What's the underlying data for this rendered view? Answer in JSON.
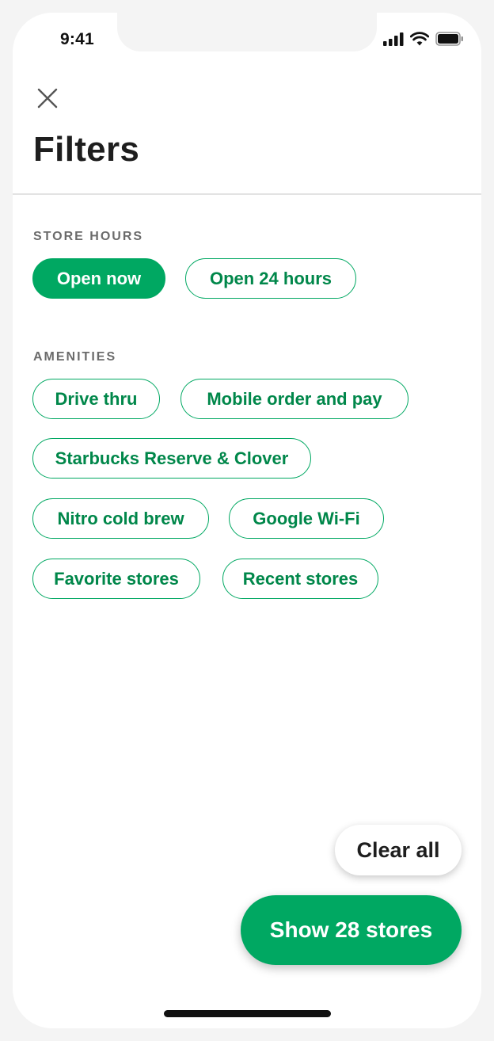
{
  "status_bar": {
    "time": "9:41",
    "icons": [
      "cellular-signal-icon",
      "wifi-icon",
      "battery-icon"
    ]
  },
  "header": {
    "close_icon": "close-icon",
    "title": "Filters"
  },
  "store_hours": {
    "label": "STORE HOURS",
    "chips": [
      {
        "label": "Open now",
        "selected": true
      },
      {
        "label": "Open 24 hours",
        "selected": false
      }
    ]
  },
  "amenities": {
    "label": "AMENITIES",
    "chips": [
      {
        "label": "Drive thru",
        "selected": false
      },
      {
        "label": "Mobile order and pay",
        "selected": false
      },
      {
        "label": "Starbucks Reserve & Clover",
        "selected": false
      },
      {
        "label": "Nitro cold brew",
        "selected": false
      },
      {
        "label": "Google Wi-Fi",
        "selected": false
      },
      {
        "label": "Favorite stores",
        "selected": false
      },
      {
        "label": "Recent stores",
        "selected": false
      }
    ]
  },
  "actions": {
    "clear_all": "Clear all",
    "show_results": "Show 28 stores"
  },
  "colors": {
    "accent": "#00a862",
    "accent_text": "#00874a",
    "title": "#1e1e1e",
    "section_label": "#6b6b6b"
  }
}
